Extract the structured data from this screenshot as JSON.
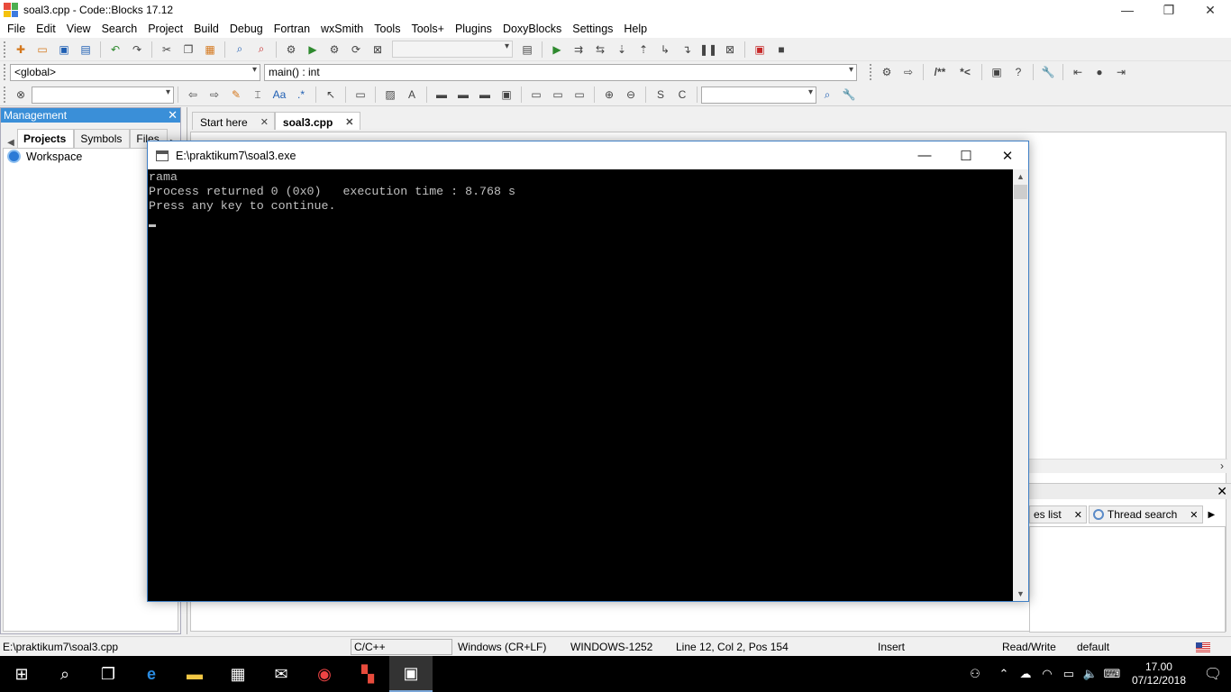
{
  "window": {
    "title": "soal3.cpp - Code::Blocks 17.12",
    "minimize": "—",
    "maximize": "❐",
    "close": "✕"
  },
  "menu": [
    "File",
    "Edit",
    "View",
    "Search",
    "Project",
    "Build",
    "Debug",
    "Fortran",
    "wxSmith",
    "Tools",
    "Tools+",
    "Plugins",
    "DoxyBlocks",
    "Settings",
    "Help"
  ],
  "toolbar2": {
    "scope": "<global>",
    "function": "main() : int",
    "doxy_block": "/**",
    "doxy_line": "*<"
  },
  "management": {
    "title": "Management",
    "tabs": [
      "Projects",
      "Symbols",
      "Files"
    ],
    "active_tab": "Projects",
    "tree": [
      {
        "label": "Workspace"
      }
    ]
  },
  "editor": {
    "tabs": [
      {
        "label": "Start here"
      },
      {
        "label": "soal3.cpp"
      }
    ],
    "active_tab": "soal3.cpp"
  },
  "logs": {
    "tabs": [
      {
        "label": "es list"
      },
      {
        "label": "Thread search"
      }
    ]
  },
  "console": {
    "title": "E:\\praktikum7\\soal3.exe",
    "lines": [
      "rama",
      "",
      "Process returned 0 (0x0)   execution time : 8.768 s",
      "Press any key to continue."
    ]
  },
  "statusbar": {
    "file_path": "E:\\praktikum7\\soal3.cpp",
    "language": "C/C++",
    "line_endings": "Windows (CR+LF)",
    "encoding": "WINDOWS-1252",
    "position": "Line 12, Col 2, Pos 154",
    "mode": "Insert",
    "access": "Read/Write",
    "profile": "default"
  },
  "taskbar": {
    "time": "17.00",
    "date": "07/12/2018"
  }
}
